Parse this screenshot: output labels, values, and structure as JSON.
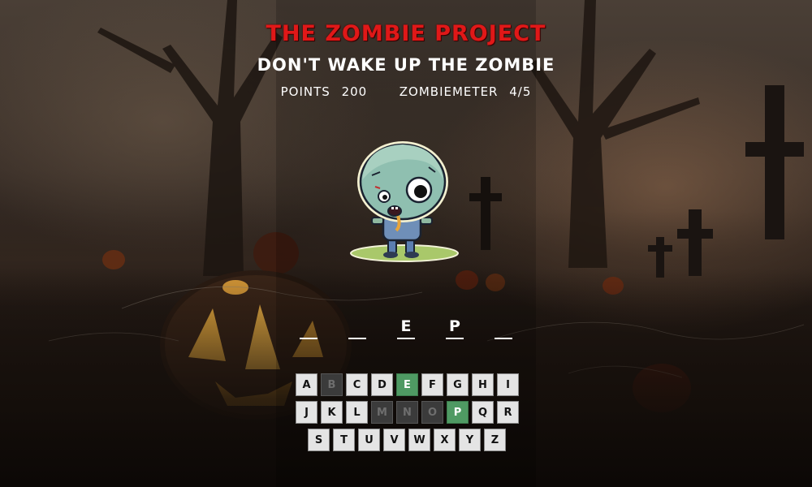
{
  "header": {
    "title": "THE ZOMBIE PROJECT",
    "subtitle": "DON'T WAKE UP THE ZOMBIE",
    "points_label": "POINTS",
    "points_value": "200",
    "meter_label": "ZOMBIEMETER",
    "meter_value": "4/5"
  },
  "word": {
    "slots": [
      "",
      "",
      "E",
      "P",
      ""
    ]
  },
  "keyboard": {
    "rows": [
      [
        {
          "letter": "A",
          "state": "available"
        },
        {
          "letter": "B",
          "state": "used"
        },
        {
          "letter": "C",
          "state": "available"
        },
        {
          "letter": "D",
          "state": "available"
        },
        {
          "letter": "E",
          "state": "hit"
        },
        {
          "letter": "F",
          "state": "available"
        },
        {
          "letter": "G",
          "state": "available"
        },
        {
          "letter": "H",
          "state": "available"
        },
        {
          "letter": "I",
          "state": "available"
        }
      ],
      [
        {
          "letter": "J",
          "state": "available"
        },
        {
          "letter": "K",
          "state": "available"
        },
        {
          "letter": "L",
          "state": "available"
        },
        {
          "letter": "M",
          "state": "used"
        },
        {
          "letter": "N",
          "state": "used"
        },
        {
          "letter": "O",
          "state": "used"
        },
        {
          "letter": "P",
          "state": "hit"
        },
        {
          "letter": "Q",
          "state": "available"
        },
        {
          "letter": "R",
          "state": "available"
        }
      ],
      [
        {
          "letter": "S",
          "state": "available"
        },
        {
          "letter": "T",
          "state": "available"
        },
        {
          "letter": "U",
          "state": "available"
        },
        {
          "letter": "V",
          "state": "available"
        },
        {
          "letter": "W",
          "state": "available"
        },
        {
          "letter": "X",
          "state": "available"
        },
        {
          "letter": "Y",
          "state": "available"
        },
        {
          "letter": "Z",
          "state": "available"
        }
      ]
    ]
  },
  "colors": {
    "title": "#e01818",
    "hit_key": "#4f9a63",
    "used_key": "#3b3b3b",
    "available_key": "#e4e4e4"
  }
}
